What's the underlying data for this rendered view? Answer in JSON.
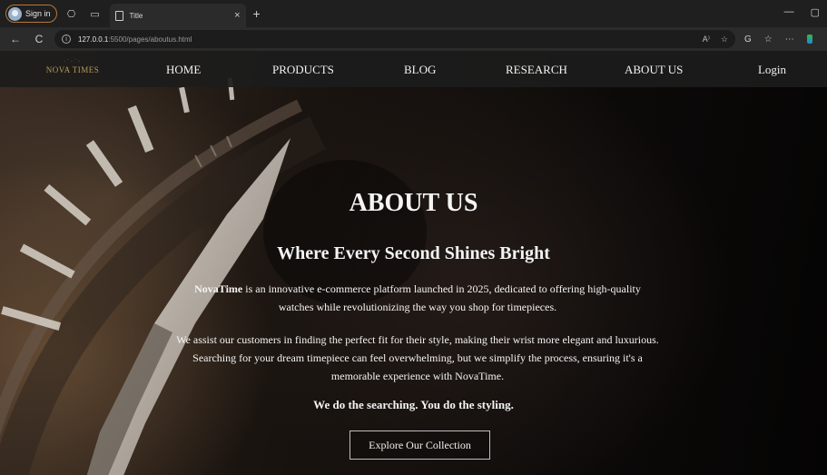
{
  "browser": {
    "signin_label": "Sign in",
    "tab_title": "Title",
    "tab_close": "×",
    "new_tab": "+",
    "url_host": "127.0.0.1",
    "url_rest": ":5500/pages/aboutus.html",
    "url_icons": [
      "A⁾",
      "☆"
    ],
    "window_controls": [
      "—",
      "▢"
    ],
    "nav_icons": {
      "back": "←",
      "reload": "C"
    }
  },
  "site": {
    "logo_text": "NOVA TIMES",
    "nav": [
      "HOME",
      "PRODUCTS",
      "BLOG",
      "RESEARCH",
      "ABOUT US"
    ],
    "login": "Login"
  },
  "hero": {
    "title": "ABOUT US",
    "subtitle": "Where Every Second Shines Bright",
    "p1_brand": "NovaTime",
    "p1_rest": " is an innovative e-commerce platform launched in 2025, dedicated to offering high-quality watches while revolutionizing the way you shop for timepieces.",
    "p2": "We assist our customers in finding the perfect fit for their style, making their wrist more elegant and luxurious. Searching for your dream timepiece can feel overwhelming, but we simplify the process, ensuring it's a memorable experience with NovaTime.",
    "tagline": "We do the searching. You do the styling.",
    "cta": "Explore Our Collection"
  },
  "colors": {
    "nav_bg": "#1c1c1c",
    "logo_gold": "#b89a5a",
    "text": "#f4f4f4",
    "signin_border": "#b8763a"
  }
}
